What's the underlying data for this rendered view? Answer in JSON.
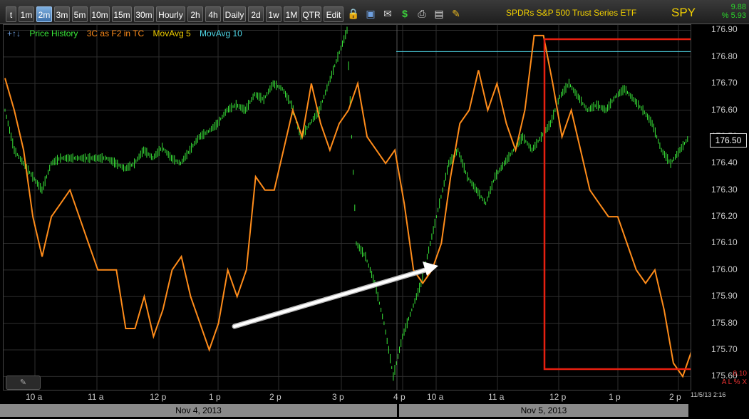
{
  "toolbar": {
    "intervals": [
      "t",
      "1m",
      "2m",
      "3m",
      "5m",
      "10m",
      "15m",
      "30m",
      "Hourly",
      "2h",
      "4h",
      "Daily",
      "2d",
      "1w",
      "1M",
      "QTR",
      "Edit"
    ],
    "active_interval": "2m",
    "icons": [
      "lock-icon",
      "save-icon",
      "mail-icon",
      "dollar-icon",
      "print-icon",
      "message-icon",
      "pencil-icon"
    ]
  },
  "header": {
    "title": "SPDRs S&P 500 Trust Series ETF",
    "symbol": "SPY",
    "change": "9.88",
    "change_pct": "% 5.93"
  },
  "legend": {
    "arrows": "+↑↓",
    "items": [
      {
        "label": "Price History",
        "color": "#39e639"
      },
      {
        "label": "3C as F2 in TC",
        "color": "#ff8c1a"
      },
      {
        "label": "MovAvg 5",
        "color": "#f2d000"
      },
      {
        "label": "MovAvg 10",
        "color": "#4fd8e8"
      }
    ]
  },
  "yaxis": {
    "ticks": [
      "176.90",
      "176.80",
      "176.70",
      "176.60",
      "176.50",
      "176.40",
      "176.30",
      "176.20",
      "176.10",
      "176.00",
      "175.90",
      "175.80",
      "175.70",
      "175.60"
    ],
    "current_price": "176.50"
  },
  "xaxis": {
    "ticks": [
      "10 a",
      "11 a",
      "12 p",
      "1 p",
      "2 p",
      "3 p",
      "4 p",
      "10 a",
      "11 a",
      "12 p",
      "1 p",
      "2 p"
    ]
  },
  "dates": [
    "Nov 4, 2013",
    "Nov 5, 2013"
  ],
  "bottom": {
    "value": "0.10",
    "labels": "A L % X",
    "timestamp": "11/5/13 2:16"
  },
  "colors": {
    "price": "#39e639",
    "indicator": "#ff8c1a",
    "movavg10": "#4fd8e8",
    "highlight": "#e82010",
    "arrow": "#ffffff"
  },
  "chart_data": {
    "type": "line",
    "ylim": [
      175.55,
      176.92
    ],
    "series": [
      {
        "name": "Price History",
        "values": [
          176.6,
          176.45,
          176.4,
          176.35,
          176.3,
          176.4,
          176.42,
          176.42,
          176.42,
          176.42,
          176.42,
          176.42,
          176.4,
          176.38,
          176.4,
          176.45,
          176.42,
          176.46,
          176.42,
          176.4,
          176.45,
          176.5,
          176.52,
          176.55,
          176.6,
          176.62,
          176.6,
          176.66,
          176.64,
          176.7,
          176.68,
          176.62,
          176.5,
          176.55,
          176.6,
          176.7,
          176.8,
          176.9,
          176.1,
          176.05,
          175.95,
          175.8,
          175.6,
          175.75,
          175.85,
          175.95,
          176.1,
          176.25,
          176.4,
          176.45,
          176.35,
          176.3,
          176.25,
          176.35,
          176.4,
          176.45,
          176.5,
          176.45,
          176.5,
          176.55,
          176.65,
          176.7,
          176.65,
          176.6,
          176.62,
          176.6,
          176.65,
          176.68,
          176.64,
          176.6,
          176.55,
          176.45,
          176.4,
          176.45,
          176.5
        ]
      },
      {
        "name": "3C as F2 in TC",
        "values": [
          176.72,
          176.6,
          176.45,
          176.2,
          176.05,
          176.2,
          176.25,
          176.3,
          176.2,
          176.1,
          176.0,
          176.0,
          176.0,
          175.78,
          175.78,
          175.9,
          175.75,
          175.85,
          176.0,
          176.05,
          175.9,
          175.8,
          175.7,
          175.8,
          176.0,
          175.9,
          176.0,
          176.35,
          176.3,
          176.3,
          176.45,
          176.6,
          176.5,
          176.7,
          176.55,
          176.45,
          176.55,
          176.6,
          176.7,
          176.5,
          176.45,
          176.4,
          176.45,
          176.25,
          176.0,
          175.95,
          176.0,
          176.1,
          176.35,
          176.55,
          176.6,
          176.75,
          176.6,
          176.7,
          176.55,
          176.45,
          176.6,
          176.88,
          176.88,
          176.7,
          176.5,
          176.6,
          176.45,
          176.3,
          176.25,
          176.2,
          176.2,
          176.1,
          176.0,
          175.95,
          176.0,
          175.85,
          175.65,
          175.6,
          175.7
        ]
      },
      {
        "name": "MovAvg 10",
        "values": [
          176.82,
          176.82
        ]
      }
    ]
  }
}
